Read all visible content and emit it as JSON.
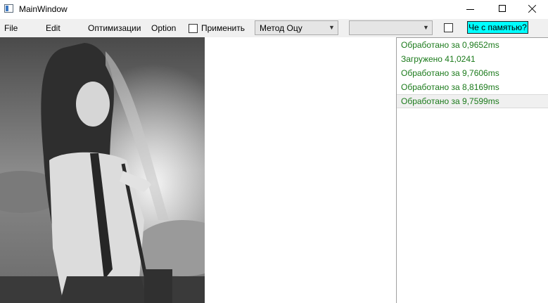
{
  "window": {
    "title": "MainWindow",
    "minimize_icon": "minimize-icon",
    "maximize_icon": "maximize-icon",
    "close_icon": "close-icon"
  },
  "menu": {
    "file": "File",
    "edit": "Edit",
    "optimizations": "Оптимизации",
    "option": "Option"
  },
  "toolbar": {
    "apply_label": "Применить",
    "apply_checked": false,
    "method_combo_value": "Метод Оцу",
    "second_combo_value": "",
    "extra_checkbox_checked": false,
    "memory_button_label": "Че с памятью?",
    "memory_button_color": "#00ffff"
  },
  "image": {
    "description_icon": "grayscale-anime-girl-image"
  },
  "log": {
    "text_color": "#1b7a1b",
    "items": [
      "Обработано за 0,9652ms",
      "Загружено 41,0241",
      "Обработано за 9,7606ms",
      "Обработано за 8,8169ms",
      "Обработано за 9,7599ms"
    ],
    "selected_index": 4
  }
}
